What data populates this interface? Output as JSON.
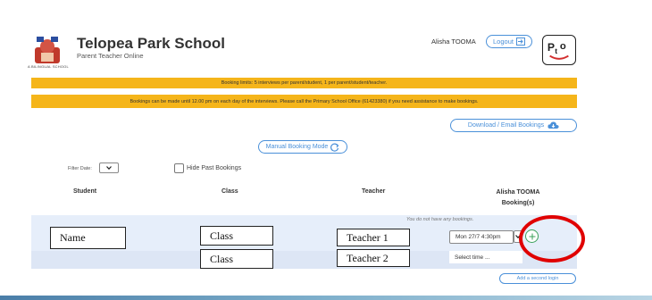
{
  "header": {
    "school_name": "Telopea Park School",
    "subtitle": "Parent Teacher Online",
    "logo_caption": "A BILINGUAL SCHOOL",
    "user_name": "Alisha TOOMA",
    "logout_label": "Logout",
    "pto_logo_text": "PtO"
  },
  "banners": {
    "limits": "Booking limits: 5 interviews per parent/student, 1 per parent/student/teacher.",
    "notice": "Bookings can be made until 12.00 pm on each day of the interviews. Please call the Primary School Office (61423380) if you need assistance to make bookings."
  },
  "actions": {
    "download_label": "Download / Email Bookings",
    "manual_mode_label": "Manual Booking Mode",
    "second_login_label": "Add a second login"
  },
  "filters": {
    "filter_date_label": "Filter Date:",
    "hide_past_label": "Hide Past Bookings"
  },
  "table": {
    "headers": {
      "student": "Student",
      "class": "Class",
      "teacher": "Teacher",
      "booking": "Alisha TOOMA Booking(s)"
    },
    "no_bookings": "You do not have any bookings.",
    "rows": [
      {
        "student": "Name",
        "class": "Class",
        "teacher": "Teacher 1",
        "time": "Mon 27/7 4:30pm"
      },
      {
        "student": "",
        "class": "Class",
        "teacher": "Teacher 2",
        "time": "Select time ..."
      }
    ]
  },
  "colors": {
    "accent": "#4a90d9",
    "banner": "#f5b51a",
    "highlight": "#e00000",
    "add": "#3aa15a"
  }
}
